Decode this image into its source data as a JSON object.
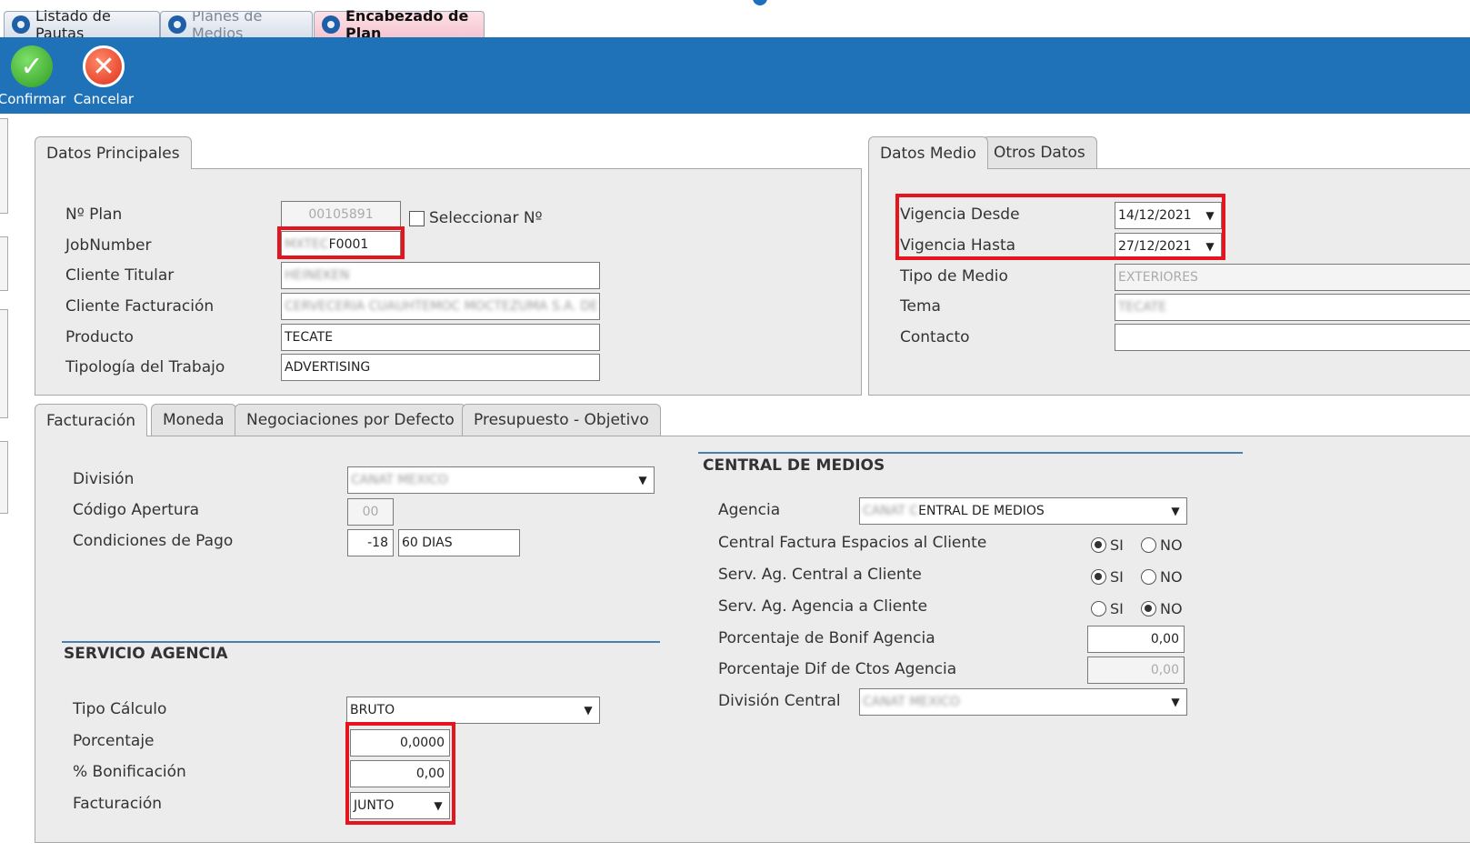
{
  "tabs": [
    {
      "label": "Listado de Pautas"
    },
    {
      "label": "Planes de Medios"
    },
    {
      "label": "Encabezado de Plan"
    }
  ],
  "toolbar": {
    "confirm_label": "Confirmar",
    "cancel_label": "Cancelar"
  },
  "principal": {
    "tab_label": "Datos Principales",
    "plan_label": "Nº Plan",
    "plan_value": "00105891",
    "select_label": "Seleccionar Nº",
    "job_label": "JobNumber",
    "job_value_blur": "MXTEC",
    "job_value": "F0001",
    "cliente_titular_label": "Cliente Titular",
    "cliente_titular_value": "HEINEKEN",
    "cliente_fact_label": "Cliente Facturación",
    "cliente_fact_value": "CERVECERIA CUAUHTEMOC MOCTEZUMA S.A. DE C.V.",
    "producto_label": "Producto",
    "producto_value": "TECATE",
    "tipologia_label": "Tipología del Trabajo",
    "tipologia_value": "ADVERTISING"
  },
  "medio": {
    "tab_label": "Datos Medio",
    "tab2_label": "Otros Datos",
    "desde_label": "Vigencia Desde",
    "desde_value": "14/12/2021",
    "hasta_label": "Vigencia Hasta",
    "hasta_value": "27/12/2021",
    "tipo_label": "Tipo de Medio",
    "tipo_value": "EXTERIORES",
    "tema_label": "Tema",
    "tema_value": "TECATE",
    "contacto_label": "Contacto",
    "contacto_value": ""
  },
  "lower_tabs": [
    {
      "label": "Facturación"
    },
    {
      "label": "Moneda"
    },
    {
      "label": "Negociaciones por Defecto"
    },
    {
      "label": "Presupuesto - Objetivo"
    }
  ],
  "facturacion": {
    "division_label": "División",
    "division_value": "CANAT MEXICO",
    "codigo_label": "Código Apertura",
    "codigo_value": "00",
    "condiciones_label": "Condiciones de Pago",
    "condiciones_code": "-18",
    "condiciones_value": "60 DIAS"
  },
  "servicio": {
    "title": "SERVICIO AGENCIA",
    "tipo_label": "Tipo Cálculo",
    "tipo_value": "BRUTO",
    "porcentaje_label": "Porcentaje",
    "porcentaje_value": "0,0000",
    "bonif_label": "% Bonificación",
    "bonif_value": "0,00",
    "facturacion_label": "Facturación",
    "facturacion_value": "JUNTO"
  },
  "central": {
    "title": "CENTRAL DE MEDIOS",
    "agencia_label": "Agencia",
    "agencia_blur": "CANAT C",
    "agencia_value": "ENTRAL DE MEDIOS",
    "row1_label": "Central Factura Espacios al Cliente",
    "row2_label": "Serv. Ag. Central a Cliente",
    "row3_label": "Serv. Ag. Agencia a Cliente",
    "si_label": "SI",
    "no_label": "NO",
    "bonif_label": "Porcentaje de Bonif Agencia",
    "bonif_value": "0,00",
    "dif_label": "Porcentaje Dif de Ctos Agencia",
    "dif_value": "0,00",
    "division_label": "División Central",
    "division_value": "CANAT MEXICO"
  },
  "colors": {
    "toolbar": "#1f72b8",
    "highlight": "#e5141f",
    "panel": "#ececec"
  }
}
